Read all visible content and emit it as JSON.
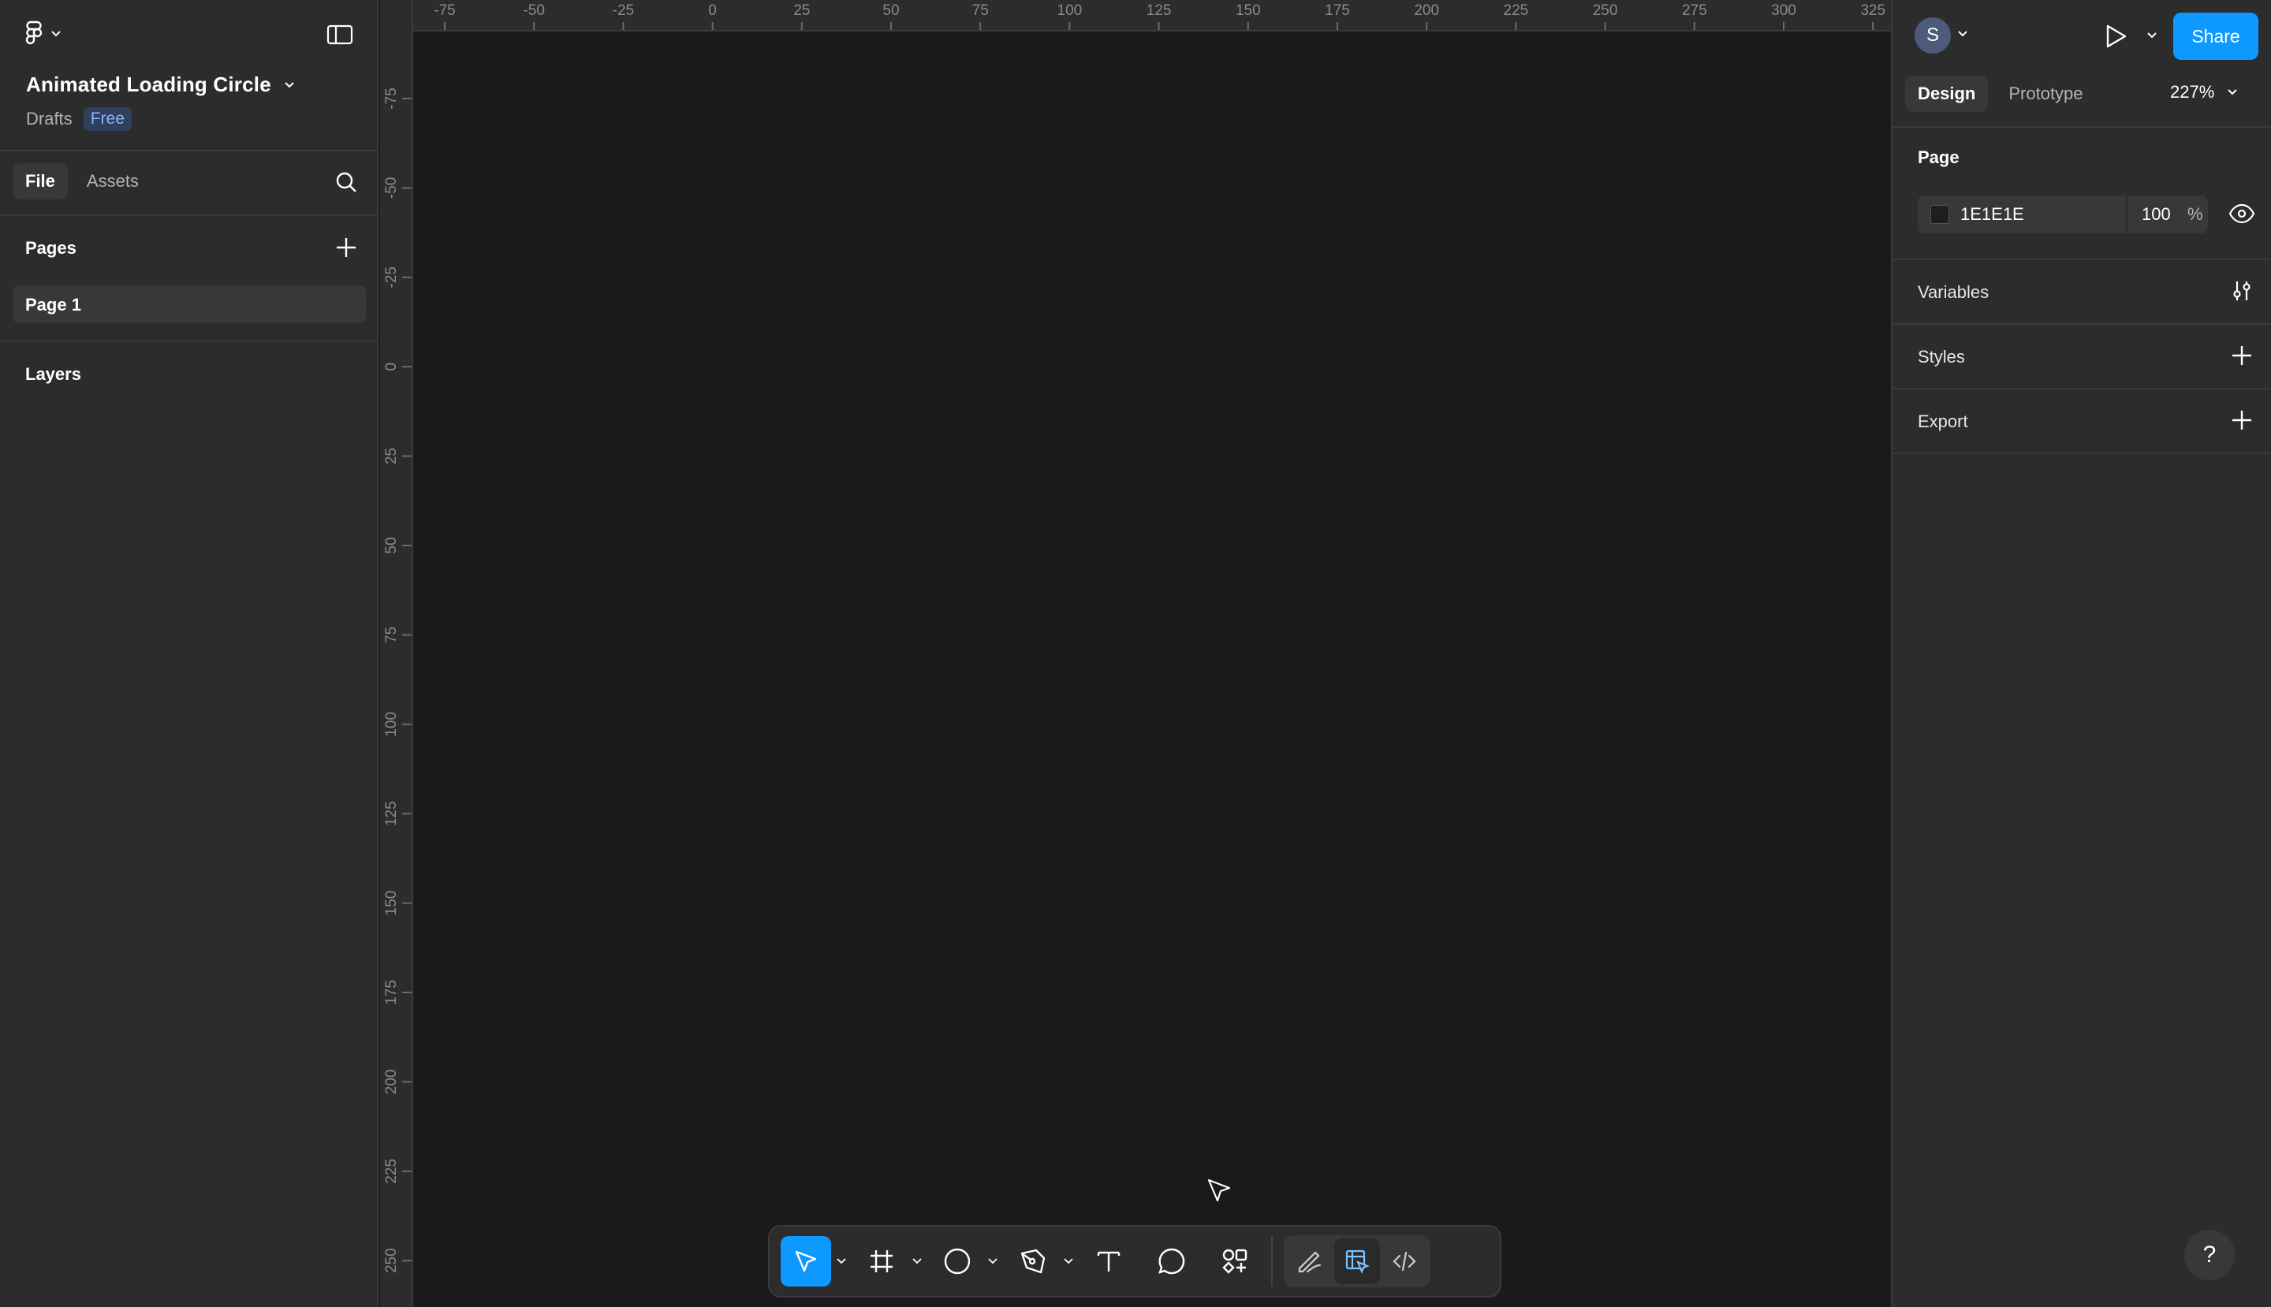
{
  "app": {
    "menu_icon": "figma-logo-icon",
    "file_title": "Animated Loading Circle",
    "location": "Drafts",
    "plan_badge": "Free"
  },
  "left_panel": {
    "tabs": [
      {
        "label": "File",
        "active": true
      },
      {
        "label": "Assets",
        "active": false
      }
    ],
    "pages_title": "Pages",
    "pages": [
      {
        "label": "Page 1",
        "selected": true
      }
    ],
    "layers_title": "Layers"
  },
  "rulers": {
    "horizontal": [
      "-75",
      "-50",
      "-25",
      "0",
      "25",
      "50",
      "75",
      "100",
      "125",
      "150",
      "175",
      "200",
      "225",
      "250",
      "275",
      "300",
      "325"
    ],
    "vertical": [
      "-75",
      "-50",
      "-25",
      "0",
      "25",
      "50",
      "75",
      "100",
      "125",
      "150",
      "175",
      "200",
      "225",
      "250"
    ]
  },
  "right_panel": {
    "avatar_initial": "S",
    "share_label": "Share",
    "tabs": [
      {
        "label": "Design",
        "active": true
      },
      {
        "label": "Prototype",
        "active": false
      }
    ],
    "zoom": "227%",
    "page_section": {
      "title": "Page",
      "color_hex": "1E1E1E",
      "opacity": "100",
      "opacity_unit": "%"
    },
    "sections": [
      {
        "label": "Variables",
        "icon": "sliders-icon"
      },
      {
        "label": "Styles",
        "icon": "plus-icon"
      },
      {
        "label": "Export",
        "icon": "plus-icon"
      }
    ],
    "help_label": "?"
  },
  "toolbar": {
    "tools": [
      {
        "name": "move",
        "icon": "move-cursor-icon",
        "active": true
      },
      {
        "name": "frame",
        "icon": "frame-hash-icon"
      },
      {
        "name": "shape",
        "icon": "ellipse-icon"
      },
      {
        "name": "pen",
        "icon": "pen-tool-icon"
      },
      {
        "name": "text",
        "icon": "text-icon"
      },
      {
        "name": "comment",
        "icon": "comment-icon"
      },
      {
        "name": "actions",
        "icon": "actions-icon"
      }
    ],
    "modes": [
      {
        "name": "draw",
        "icon": "draw-mode-icon"
      },
      {
        "name": "design",
        "icon": "design-mode-icon",
        "active": true
      },
      {
        "name": "dev",
        "icon": "dev-mode-icon"
      }
    ]
  },
  "colors": {
    "accent": "#0d99ff",
    "panel_bg": "#2c2c2c",
    "canvas_bg": "#1a1a1a",
    "page_color": "#1E1E1E"
  }
}
